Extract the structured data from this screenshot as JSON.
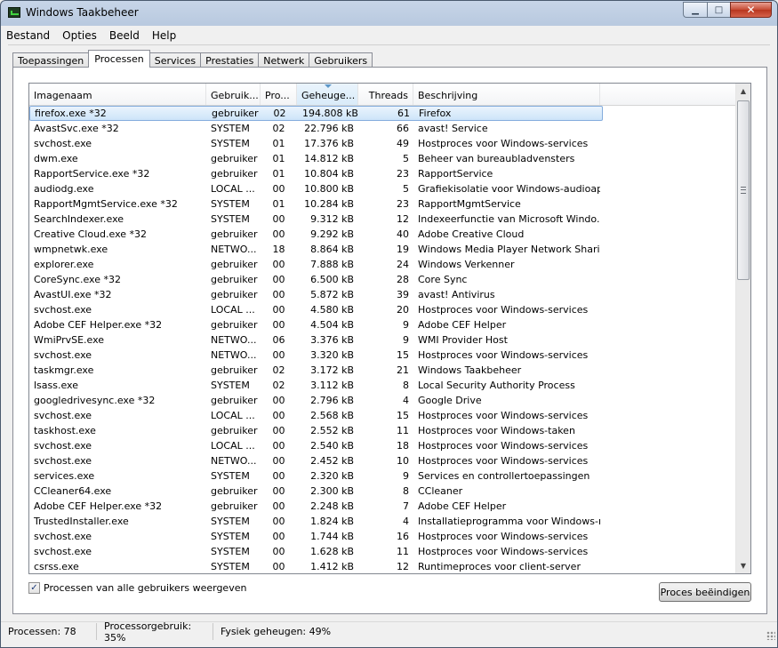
{
  "window": {
    "title": "Windows Taakbeheer"
  },
  "menu": [
    "Bestand",
    "Opties",
    "Beeld",
    "Help"
  ],
  "tabs": [
    "Toepassingen",
    "Processen",
    "Services",
    "Prestaties",
    "Netwerk",
    "Gebruikers"
  ],
  "active_tab": "Processen",
  "columns": {
    "name": "Imagenaam",
    "user": "Gebruik...",
    "cpu": "Pro...",
    "mem": "Geheuge...",
    "threads": "Threads",
    "desc": "Beschrijving"
  },
  "processes": [
    {
      "name": "firefox.exe *32",
      "user": "gebruiker",
      "cpu": "02",
      "mem": "194.808 kB",
      "threads": "61",
      "desc": "Firefox"
    },
    {
      "name": "AvastSvc.exe *32",
      "user": "SYSTEM",
      "cpu": "02",
      "mem": "22.796 kB",
      "threads": "66",
      "desc": "avast! Service"
    },
    {
      "name": "svchost.exe",
      "user": "SYSTEM",
      "cpu": "01",
      "mem": "17.376 kB",
      "threads": "49",
      "desc": "Hostproces voor Windows-services"
    },
    {
      "name": "dwm.exe",
      "user": "gebruiker",
      "cpu": "01",
      "mem": "14.812 kB",
      "threads": "5",
      "desc": "Beheer van bureaubladvensters"
    },
    {
      "name": "RapportService.exe *32",
      "user": "gebruiker",
      "cpu": "01",
      "mem": "10.804 kB",
      "threads": "23",
      "desc": "RapportService"
    },
    {
      "name": "audiodg.exe",
      "user": "LOCAL ...",
      "cpu": "00",
      "mem": "10.800 kB",
      "threads": "5",
      "desc": "Grafiekisolatie voor Windows-audioap..."
    },
    {
      "name": "RapportMgmtService.exe *32",
      "user": "SYSTEM",
      "cpu": "01",
      "mem": "10.284 kB",
      "threads": "23",
      "desc": "RapportMgmtService"
    },
    {
      "name": "SearchIndexer.exe",
      "user": "SYSTEM",
      "cpu": "00",
      "mem": "9.312 kB",
      "threads": "12",
      "desc": "Indexeerfunctie van Microsoft Windo..."
    },
    {
      "name": "Creative Cloud.exe *32",
      "user": "gebruiker",
      "cpu": "00",
      "mem": "9.292 kB",
      "threads": "40",
      "desc": "Adobe Creative Cloud"
    },
    {
      "name": "wmpnetwk.exe",
      "user": "NETWO...",
      "cpu": "18",
      "mem": "8.864 kB",
      "threads": "19",
      "desc": "Windows Media Player Network Sharin..."
    },
    {
      "name": "explorer.exe",
      "user": "gebruiker",
      "cpu": "00",
      "mem": "7.888 kB",
      "threads": "24",
      "desc": "Windows Verkenner"
    },
    {
      "name": "CoreSync.exe *32",
      "user": "gebruiker",
      "cpu": "00",
      "mem": "6.500 kB",
      "threads": "28",
      "desc": "Core Sync"
    },
    {
      "name": "AvastUI.exe *32",
      "user": "gebruiker",
      "cpu": "00",
      "mem": "5.872 kB",
      "threads": "39",
      "desc": "avast! Antivirus"
    },
    {
      "name": "svchost.exe",
      "user": "LOCAL ...",
      "cpu": "00",
      "mem": "4.580 kB",
      "threads": "20",
      "desc": "Hostproces voor Windows-services"
    },
    {
      "name": "Adobe CEF Helper.exe *32",
      "user": "gebruiker",
      "cpu": "00",
      "mem": "4.504 kB",
      "threads": "9",
      "desc": "Adobe CEF Helper"
    },
    {
      "name": "WmiPrvSE.exe",
      "user": "NETWO...",
      "cpu": "06",
      "mem": "3.376 kB",
      "threads": "9",
      "desc": "WMI Provider Host"
    },
    {
      "name": "svchost.exe",
      "user": "NETWO...",
      "cpu": "00",
      "mem": "3.320 kB",
      "threads": "15",
      "desc": "Hostproces voor Windows-services"
    },
    {
      "name": "taskmgr.exe",
      "user": "gebruiker",
      "cpu": "02",
      "mem": "3.172 kB",
      "threads": "21",
      "desc": "Windows Taakbeheer"
    },
    {
      "name": "lsass.exe",
      "user": "SYSTEM",
      "cpu": "02",
      "mem": "3.112 kB",
      "threads": "8",
      "desc": "Local Security Authority Process"
    },
    {
      "name": "googledrivesync.exe *32",
      "user": "gebruiker",
      "cpu": "00",
      "mem": "2.796 kB",
      "threads": "4",
      "desc": "Google Drive"
    },
    {
      "name": "svchost.exe",
      "user": "LOCAL ...",
      "cpu": "00",
      "mem": "2.568 kB",
      "threads": "15",
      "desc": "Hostproces voor Windows-services"
    },
    {
      "name": "taskhost.exe",
      "user": "gebruiker",
      "cpu": "00",
      "mem": "2.552 kB",
      "threads": "11",
      "desc": "Hostproces voor Windows-taken"
    },
    {
      "name": "svchost.exe",
      "user": "LOCAL ...",
      "cpu": "00",
      "mem": "2.540 kB",
      "threads": "18",
      "desc": "Hostproces voor Windows-services"
    },
    {
      "name": "svchost.exe",
      "user": "NETWO...",
      "cpu": "00",
      "mem": "2.452 kB",
      "threads": "10",
      "desc": "Hostproces voor Windows-services"
    },
    {
      "name": "services.exe",
      "user": "SYSTEM",
      "cpu": "00",
      "mem": "2.320 kB",
      "threads": "9",
      "desc": "Services en controllertoepassingen"
    },
    {
      "name": "CCleaner64.exe",
      "user": "gebruiker",
      "cpu": "00",
      "mem": "2.300 kB",
      "threads": "8",
      "desc": "CCleaner"
    },
    {
      "name": "Adobe CEF Helper.exe *32",
      "user": "gebruiker",
      "cpu": "00",
      "mem": "2.248 kB",
      "threads": "7",
      "desc": "Adobe CEF Helper"
    },
    {
      "name": "TrustedInstaller.exe",
      "user": "SYSTEM",
      "cpu": "00",
      "mem": "1.824 kB",
      "threads": "4",
      "desc": "Installatieprogramma voor Windows-m..."
    },
    {
      "name": "svchost.exe",
      "user": "SYSTEM",
      "cpu": "00",
      "mem": "1.744 kB",
      "threads": "16",
      "desc": "Hostproces voor Windows-services"
    },
    {
      "name": "svchost.exe",
      "user": "SYSTEM",
      "cpu": "00",
      "mem": "1.628 kB",
      "threads": "11",
      "desc": "Hostproces voor Windows-services"
    },
    {
      "name": "csrss.exe",
      "user": "SYSTEM",
      "cpu": "00",
      "mem": "1.412 kB",
      "threads": "12",
      "desc": "Runtimeproces voor client-server"
    }
  ],
  "show_all_users": {
    "label": "Processen van alle gebruikers weergeven",
    "checked": true,
    "mark": "✓"
  },
  "end_process_button": "Proces beëindigen",
  "status": {
    "processes": "Processen: 78",
    "cpu": "Processorgebruik: 35%",
    "memory": "Fysiek geheugen: 49%"
  }
}
